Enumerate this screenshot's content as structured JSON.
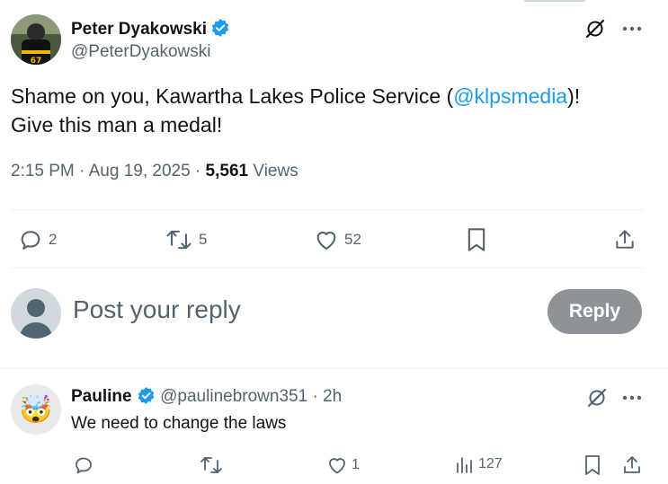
{
  "tweet": {
    "author_name": "Peter Dyakowski",
    "author_handle": "@PeterDyakowski",
    "text_line1_before": "Shame on you, Kawartha Lakes Police Service (",
    "mention": "@klpsmedia",
    "text_line1_after": ")!",
    "text_line2": "Give this man a medal!",
    "time": "2:15 PM",
    "date": "Aug 19, 2025",
    "sep": "·",
    "views_count": "5,561",
    "views_label": "Views",
    "jersey_number": "67"
  },
  "actions": {
    "replies": "2",
    "reposts": "5",
    "likes": "52"
  },
  "composer": {
    "placeholder": "Post your reply",
    "button_label": "Reply"
  },
  "reply": {
    "author_name": "Pauline",
    "author_handle": "@paulinebrown351",
    "sep": "·",
    "age": "2h",
    "text": "We need to change the laws",
    "avatar_emoji": "🤯",
    "likes": "1",
    "views": "127"
  },
  "colors": {
    "accent": "#1d9bf0",
    "secondary_text": "#536471",
    "reply_button": "#8f9397"
  },
  "icons": [
    "verified-badge-icon",
    "grok-icon",
    "more-icon",
    "reply-icon",
    "repost-icon",
    "like-icon",
    "bookmark-icon",
    "share-icon",
    "views-icon"
  ]
}
